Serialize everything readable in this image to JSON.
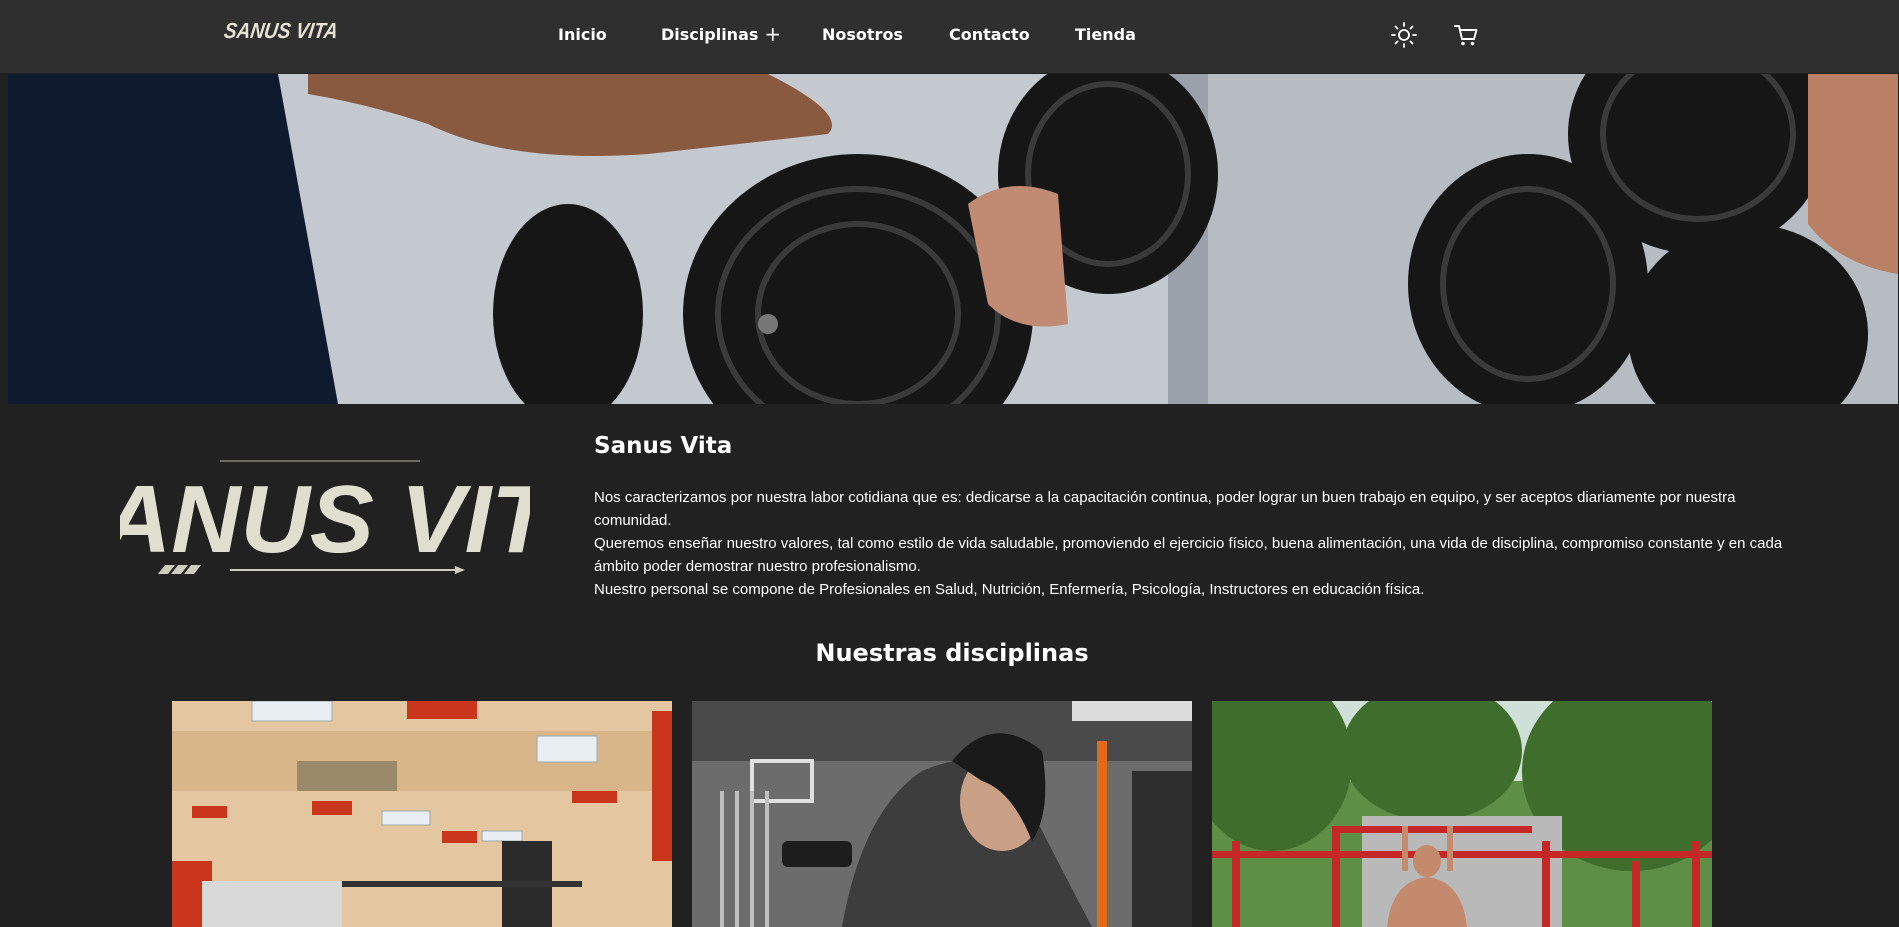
{
  "brand": {
    "name": "SANUS VITA"
  },
  "nav": {
    "links": [
      "Inicio",
      "Disciplinas",
      "Nosotros",
      "Contacto",
      "Tienda"
    ],
    "disciplinas_icon": "plus-icon"
  },
  "actions": {
    "theme_icon": "sun-icon",
    "cart_icon": "cart-icon"
  },
  "hero": {
    "image": "dumbbell-rack-photo"
  },
  "about": {
    "logo_text": "SANUS VITA",
    "title": "Sanus Vita",
    "paragraphs": [
      "Nos caracterizamos por nuestra labor cotidiana que es: dedicarse a la capacitación continua, poder lograr un buen trabajo en equipo, y ser aceptos diariamente por nuestra comunidad.",
      "Queremos enseñar nuestro valores, tal como estilo de vida saludable, promoviendo el ejercicio físico, buena alimentación, una vida de disciplina, compromiso constante y en cada ámbito poder demostrar nuestro profesionalismo.",
      "Nuestro personal se compone de Profesionales en Salud, Nutrición, Enfermería, Psicología, Instructores en educación física."
    ]
  },
  "disciplines": {
    "title": "Nuestras disciplinas",
    "cards": [
      {
        "image": "gym-interior-photo"
      },
      {
        "image": "woman-dumbbell-row-photo"
      },
      {
        "image": "outdoor-pullup-bars-photo"
      }
    ]
  },
  "colors": {
    "page_bg": "#212121",
    "navbar_bg": "#2f2f2f",
    "logo": "#e6e3d3"
  }
}
